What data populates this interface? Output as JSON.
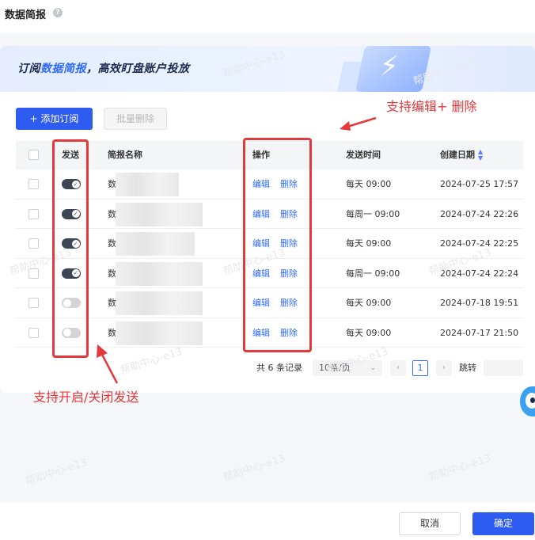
{
  "page": {
    "title": "数据简报",
    "help_icon": "question-circle-icon"
  },
  "banner": {
    "prefix": "订阅",
    "highlight": "数据简报",
    "suffix": "，高效盯盘账户投放",
    "icon": "lightning-bolt-icon"
  },
  "toolbar": {
    "add_label": "添加订阅",
    "add_icon": "plus-icon",
    "batch_delete_label": "批量删除"
  },
  "table": {
    "columns": {
      "send": "发送",
      "name": "简报名称",
      "actions": "操作",
      "send_time": "发送时间",
      "created": "创建日期"
    },
    "action_labels": {
      "edit": "编辑",
      "delete": "删除"
    },
    "rows": [
      {
        "send_on": true,
        "name": "数",
        "send_time": "每天 09:00",
        "created": "2024-07-25 17:57"
      },
      {
        "send_on": true,
        "name": "数",
        "send_time": "每周一 09:00",
        "created": "2024-07-24 22:26"
      },
      {
        "send_on": true,
        "name": "数",
        "send_time": "每天 09:00",
        "created": "2024-07-24 22:25"
      },
      {
        "send_on": true,
        "name": "数",
        "send_time": "每周一 09:00",
        "created": "2024-07-24 22:24"
      },
      {
        "send_on": false,
        "name": "数",
        "send_time": "每天 09:00",
        "created": "2024-07-18 19:51"
      },
      {
        "send_on": false,
        "name": "数",
        "send_time": "每天 09:00",
        "created": "2024-07-17 21:50"
      }
    ]
  },
  "pagination": {
    "total_prefix": "共",
    "total": "6",
    "total_suffix": "条记录",
    "page_size": "10条/页",
    "current_page": "1",
    "jump_label": "跳转"
  },
  "annotations": {
    "edit_delete": "支持编辑+ 删除",
    "toggle_send": "支持开启/关闭发送"
  },
  "watermark": "帮助中心-e13",
  "footer": {
    "cancel": "取消",
    "confirm": "确定"
  },
  "colors": {
    "primary": "#2f5cf0",
    "annotation": "#e5383b",
    "link": "#2f6bff",
    "toggle_on": "#3d4453",
    "toggle_off": "#d4d4d4"
  }
}
